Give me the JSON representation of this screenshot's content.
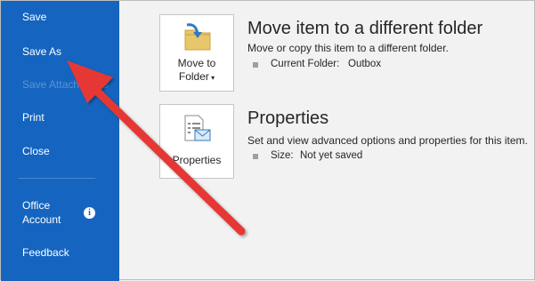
{
  "sidebar": {
    "items": [
      {
        "label": "Save"
      },
      {
        "label": "Save As"
      },
      {
        "label": "Save Attachments"
      },
      {
        "label": "Print"
      },
      {
        "label": "Close"
      },
      {
        "label": "Office\nAccount"
      },
      {
        "label": "Feedback"
      }
    ]
  },
  "move": {
    "tile_line1": "Move to",
    "tile_line2": "Folder",
    "title": "Move item to a different folder",
    "desc": "Move or copy this item to a different folder.",
    "detail_label": "Current Folder:",
    "detail_value": "Outbox"
  },
  "properties": {
    "tile_label": "Properties",
    "title": "Properties",
    "desc": "Set and view advanced options and properties for this item.",
    "detail_label": "Size:",
    "detail_value": "Not yet saved"
  },
  "colors": {
    "sidebar": "#1565c0",
    "arrow": "#e53935"
  }
}
